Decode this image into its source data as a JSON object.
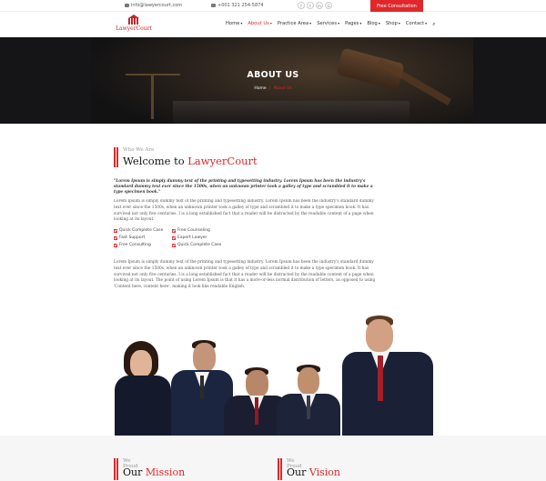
{
  "topbar": {
    "email": "info@lawyercourt.com",
    "phone": "+001 321 254-5874",
    "social_icons": [
      "facebook-icon",
      "twitter-icon",
      "linkedin-icon",
      "google-plus-icon"
    ],
    "consult_label": "Free Consultation"
  },
  "header": {
    "logo_text": "LawyerCourt",
    "nav": [
      {
        "label": "Home",
        "caret": true,
        "active": false
      },
      {
        "label": "About Us",
        "caret": true,
        "active": true
      },
      {
        "label": "Practice Area",
        "caret": true,
        "active": false
      },
      {
        "label": "Services",
        "caret": true,
        "active": false
      },
      {
        "label": "Pages",
        "caret": true,
        "active": false
      },
      {
        "label": "Blog",
        "caret": true,
        "active": false
      },
      {
        "label": "Shop",
        "caret": true,
        "active": false
      },
      {
        "label": "Contact",
        "caret": true,
        "active": false
      }
    ]
  },
  "hero": {
    "title": "ABOUT US",
    "crumb_home": "Home",
    "crumb_sep": "/",
    "crumb_current": "About Us"
  },
  "about": {
    "kicker": "Who We Are",
    "heading_prefix": "Welcome to ",
    "heading_accent": "LawyerCourt",
    "lead": "\"Lorem Ipsum is simply dummy text of the printing and typesetting industry. Lorem Ipsum has been the industry's standard dummy text ever since the 1500s, when an unknown printer took a galley of type and scrambled it to make a type specimen book.\"",
    "body1": "Lorem Ipsum is simply dummy text of the printing and typesetting industry. Lorem Ipsum has been the industry's standard dummy text ever since the 1500s, when an unknown printer took a galley of type and scrambled it to make a type specimen book. It has survived not only five centuries. I is a long established fact that a reader will be distracted by the readable content of a page when looking at its layout.",
    "checks": [
      "Quick Complete Case",
      "Free Counseling",
      "Fast Support",
      "Expert Lawyer",
      "Free Consulting",
      "Quick Complete Case"
    ],
    "body2": "Lorem Ipsum is simply dummy text of the printing and typesetting industry. Lorem Ipsum has been the industry's standard dummy text ever since the 1500s, when an unknown printer took a galley of type and scrambled it to make a type specimen book. It has survived not only five centuries. I is a long established fact that a reader will be distracted by the readable content of a page when looking at its layout. The point of using Lorem Ipsum is that it has a more-or-less normal distribution of letters, as opposed to using 'Content here, content here', making it look like readable English."
  },
  "bottom": {
    "col1": {
      "kicker": "We Proud",
      "prefix": "Our ",
      "accent": "Mission"
    },
    "col2": {
      "kicker": "We Proud",
      "prefix": "Our ",
      "accent": "Vision"
    }
  },
  "colors": {
    "accent": "#e0282b",
    "hero_bg": "#151517"
  }
}
